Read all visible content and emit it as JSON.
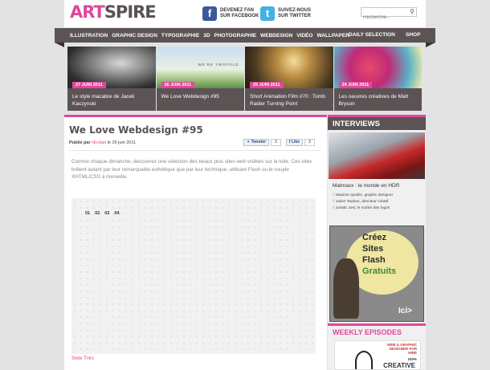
{
  "brand": {
    "art": "ART",
    "spire": "SPIRE",
    "accent": "#e0479a",
    "dark": "#5c5354"
  },
  "social": {
    "facebook_line1": "DEVENEZ FAN",
    "facebook_line2": "SUR FACEBOOK",
    "twitter_line1": "SUIVEZ-NOUS",
    "twitter_line2": "SUR TWITTER"
  },
  "search": {
    "placeholder": "Recherche..."
  },
  "nav": {
    "items": [
      "ILLUSTRATION",
      "GRAPHIC DESIGN",
      "TYPOGRAPHIE",
      "3D",
      "PHOTOGRAPHIE",
      "WEBDESIGN",
      "VIDÉO",
      "WALLPAPER"
    ],
    "daily": "DAILY SELECTION",
    "shop": "SHOP"
  },
  "featured": [
    {
      "date": "27 JUIN 2011",
      "caption": "Le style macabre de Jacek Kaczynski"
    },
    {
      "date": "26 JUIN 2011",
      "caption": "We Love Webdesign #95",
      "image_text": "WE'RE TWOFOLD"
    },
    {
      "date": "25 JUIN 2011",
      "caption": "Short Animation Film #70 : Tomb Raider Turning Point"
    },
    {
      "date": "24 JUIN 2011",
      "caption": "Les oeuvres créatives de Matt Bryson"
    }
  ],
  "article": {
    "title": "We Love Webdesign #95",
    "meta_prefix": "Publié par",
    "author": "Nicolas",
    "meta_date": "le 26 juin 2011",
    "tweet_label": "Tweeter",
    "tweet_count": "3",
    "like_label": "Like",
    "like_count": "3",
    "intro": "Comme chaque dimanche, découvrez une sélection des beaux plus sites web visibles sur la toile. Ces sites brillent autant par leur remarquable esthétique que par leur technique, utilisant Flash ou le couple XHTML/CSS à merveille.",
    "grid_columns": [
      "01",
      "02",
      "03",
      "04"
    ],
    "site_link": "Sete Trés"
  },
  "sidebar": {
    "interviews_heading": "INTERVIEWS",
    "interview_title": "Matmaxx : le monde en HDR",
    "interview_list": [
      "Maxime Quoilin, graphic designer",
      "Julien Tauban, directeur créatif",
      "Josiah Jost, le maître des logos"
    ],
    "ad": {
      "line1": "Créez",
      "line2": "Sites",
      "line3": "Flash",
      "line4": "Gratuits",
      "cta": "Ici>"
    },
    "weekly_heading": "WEEKLY EPISODES",
    "weekly_poster": "WEB & GRAPHIC DESIGNER FOR HIRE",
    "weekly_poster_number": "100%",
    "weekly_poster_word": "CREATIVE"
  }
}
